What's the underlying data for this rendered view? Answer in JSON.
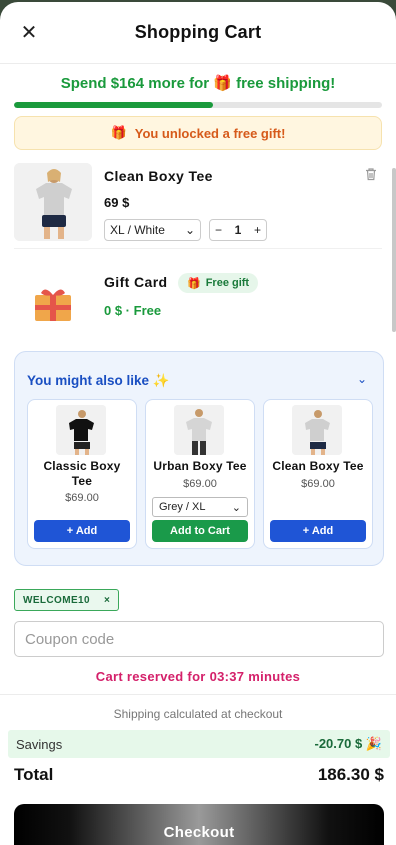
{
  "header": {
    "title": "Shopping Cart",
    "close_icon": "close-icon"
  },
  "shipping": {
    "message": "Spend $164 more for 🎁 free shipping!",
    "progress_percent": 54
  },
  "gift_banner": {
    "icon": "🎁",
    "text": "You unlocked a free gift!"
  },
  "items": [
    {
      "name": "Clean Boxy Tee",
      "price": "69 $",
      "variant": "XL / White",
      "quantity": "1",
      "minus": "−",
      "plus": "+"
    },
    {
      "name": "Gift Card",
      "badge": "Free gift",
      "badge_icon": "🎁",
      "price": "0 $ · Free"
    }
  ],
  "upsell": {
    "heading": "You might also like ✨",
    "products": [
      {
        "name": "Classic Boxy Tee",
        "price": "$69.00",
        "button": "+ Add"
      },
      {
        "name": "Urban Boxy Tee",
        "price": "$69.00",
        "variant": "Grey / XL",
        "button": "Add to Cart"
      },
      {
        "name": "Clean Boxy Tee",
        "price": "$69.00",
        "button": "+ Add"
      }
    ]
  },
  "coupon": {
    "applied_code": "WELCOME10",
    "remove": "×",
    "placeholder": "Coupon code"
  },
  "reservation": "Cart reserved for 03:37 minutes",
  "footer": {
    "shipping_note": "Shipping calculated at checkout",
    "savings_label": "Savings",
    "savings_value": "-20.70 $ 🎉",
    "total_label": "Total",
    "total_value": "186.30 $",
    "checkout_label": "Checkout"
  },
  "colors": {
    "accent_green": "#1a9a3c",
    "accent_blue": "#1f55d6",
    "timer_pink": "#d4206a"
  }
}
